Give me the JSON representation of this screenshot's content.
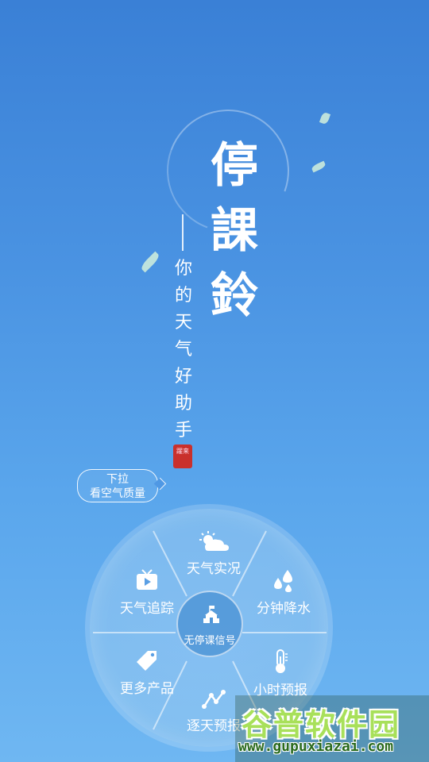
{
  "app": {
    "title_chars": [
      "停",
      "課",
      "鈴"
    ],
    "subtitle_chars": [
      "你",
      "的",
      "天",
      "气",
      "好",
      "助",
      "手"
    ],
    "seal_text": "躍来"
  },
  "pull_hint": {
    "line1": "下拉",
    "line2": "看空气质量"
  },
  "dial": {
    "center_label": "无停课信号",
    "weather_label": "天气实况",
    "rain_label": "分钟降水",
    "track_label": "天气追踪",
    "more_label": "更多产品",
    "hour_label": "小时预报",
    "daily_label": "逐天预报"
  },
  "watermark": {
    "title": "谷普软件园",
    "url": "www.gupuxiazai.com"
  },
  "colors": {
    "background_top": "#3a80d6",
    "background_bottom": "#6fb7f2",
    "seal_red": "#c9302c",
    "watermark_green": "#a8e05a"
  },
  "icons": [
    "sun-cloud-icon",
    "raindrops-icon",
    "tv-icon",
    "tag-icon",
    "thermometer-icon",
    "trend-icon",
    "school-icon"
  ]
}
